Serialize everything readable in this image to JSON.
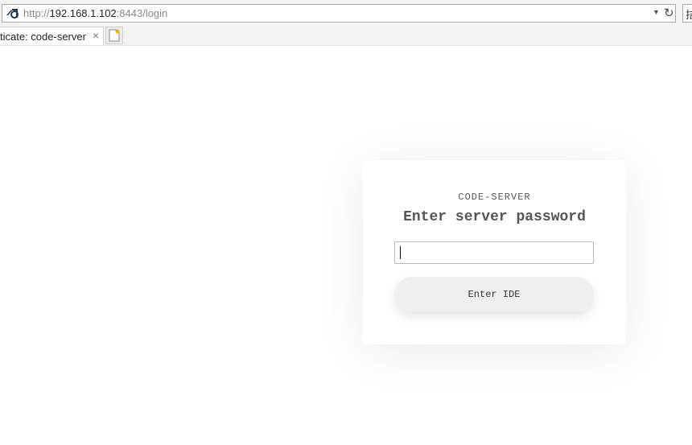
{
  "browser": {
    "url_scheme": "http://",
    "url_host": "192.168.1.102",
    "url_rest": ":8443/login",
    "right_partial_char": "拮",
    "tab": {
      "title": "ticate: code-server",
      "close_glyph": "×"
    }
  },
  "login": {
    "subtitle": "CODE-SERVER",
    "title": "Enter server password",
    "password_value": "",
    "submit_label": "Enter IDE"
  },
  "colors": {
    "card_bg": "#ffffff",
    "button_bg": "#efefef",
    "text": "#555555"
  }
}
